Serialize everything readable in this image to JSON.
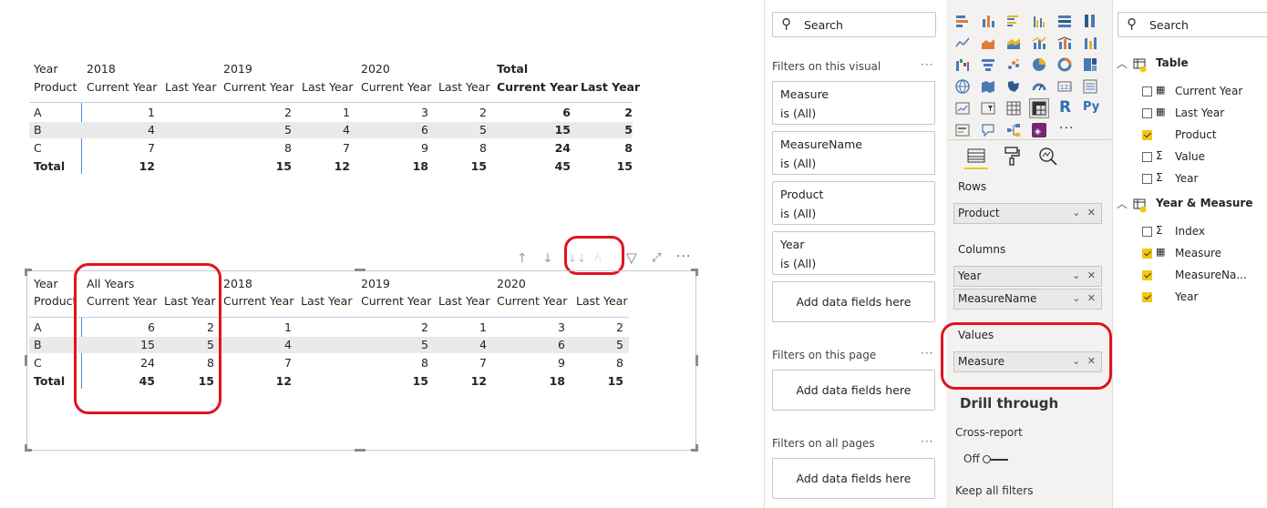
{
  "matrix1": {
    "row_header_1": "Year",
    "row_header_2": "Product",
    "years": [
      "2018",
      "2019",
      "2020"
    ],
    "total_label": "Total",
    "col_current": "Current Year",
    "col_last": "Last Year",
    "rows": [
      {
        "label": "A",
        "values": [
          "1",
          "2",
          "1",
          "3",
          "2",
          "6",
          "2"
        ]
      },
      {
        "label": "B",
        "values": [
          "4",
          "5",
          "4",
          "6",
          "5",
          "15",
          "5"
        ]
      },
      {
        "label": "C",
        "values": [
          "7",
          "8",
          "7",
          "9",
          "8",
          "24",
          "8"
        ]
      }
    ],
    "total_row": {
      "label": "Total",
      "values": [
        "12",
        "15",
        "12",
        "18",
        "15",
        "45",
        "15"
      ]
    }
  },
  "matrix2": {
    "row_header_1": "Year",
    "row_header_2": "Product",
    "groups": [
      "All Years",
      "2018",
      "2019",
      "2020"
    ],
    "col_current": "Current Year",
    "col_last": "Last Year",
    "rows": [
      {
        "label": "A",
        "values": [
          "6",
          "2",
          "1",
          "",
          "2",
          "1",
          "3",
          "2"
        ]
      },
      {
        "label": "B",
        "values": [
          "15",
          "5",
          "4",
          "",
          "5",
          "4",
          "6",
          "5"
        ]
      },
      {
        "label": "C",
        "values": [
          "24",
          "8",
          "7",
          "",
          "8",
          "7",
          "9",
          "8"
        ]
      }
    ],
    "total_row": {
      "label": "Total",
      "values": [
        "45",
        "15",
        "12",
        "",
        "15",
        "12",
        "18",
        "15"
      ]
    }
  },
  "toolbar": {
    "icons": [
      "arrow-up-icon",
      "arrow-down-icon",
      "expand-all-down-icon",
      "expand-next-level-icon",
      "filter-icon",
      "focus-mode-icon",
      "more-options-icon"
    ]
  },
  "filters": {
    "search_placeholder": "Search",
    "on_visual_title": "Filters on this visual",
    "cards": [
      {
        "name": "Measure",
        "state": "is (All)"
      },
      {
        "name": "MeasureName",
        "state": "is (All)"
      },
      {
        "name": "Product",
        "state": "is (All)"
      },
      {
        "name": "Year",
        "state": "is (All)"
      }
    ],
    "add_fields": "Add data fields here",
    "on_page_title": "Filters on this page",
    "on_all_pages_title": "Filters on all pages",
    "more": "..."
  },
  "visualizations": {
    "rows_label": "Rows",
    "rows_field": "Product",
    "columns_label": "Columns",
    "columns_fields": [
      "Year",
      "MeasureName"
    ],
    "values_label": "Values",
    "values_field": "Measure",
    "drill_title": "Drill through",
    "cross_report": "Cross-report",
    "toggle_state": "Off",
    "keep_filters": "Keep all filters"
  },
  "fields": {
    "search_placeholder": "Search",
    "tables": [
      {
        "name": "Table",
        "items": [
          {
            "name": "Current Year",
            "type": "calc",
            "checked": false
          },
          {
            "name": "Last Year",
            "type": "calc",
            "checked": false
          },
          {
            "name": "Product",
            "type": "text",
            "checked": true
          },
          {
            "name": "Value",
            "type": "sum",
            "checked": false
          },
          {
            "name": "Year",
            "type": "sum",
            "checked": false
          }
        ]
      },
      {
        "name": "Year & Measure",
        "items": [
          {
            "name": "Index",
            "type": "sum",
            "checked": false
          },
          {
            "name": "Measure",
            "type": "calc",
            "checked": true
          },
          {
            "name": "MeasureNa...",
            "type": "text",
            "checked": true
          },
          {
            "name": "Year",
            "type": "text",
            "checked": true
          }
        ]
      }
    ]
  },
  "colors": {
    "highlight": "#e0141e",
    "check": "#f2c811",
    "band": "#eaeaea"
  }
}
